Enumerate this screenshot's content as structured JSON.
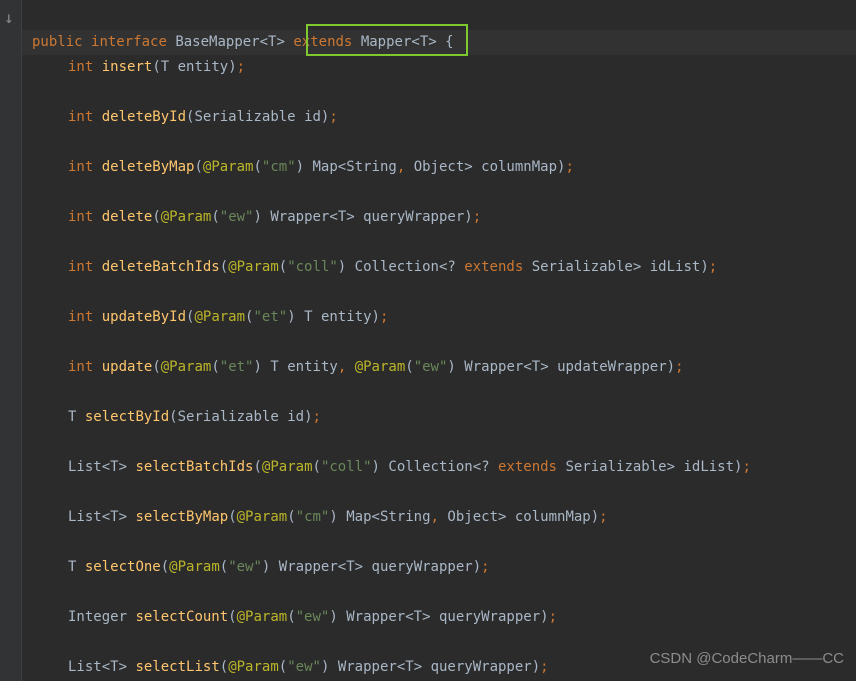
{
  "tokens": {
    "public": "public",
    "interface": "interface",
    "extends": "extends",
    "int": "int",
    "BaseMapper": "BaseMapper",
    "Mapper": "Mapper",
    "T": "T",
    "Serializable": "Serializable",
    "Map": "Map",
    "String": "String",
    "Object": "Object",
    "Wrapper": "Wrapper",
    "Collection": "Collection",
    "List": "List",
    "Integer": "Integer",
    "Param": "@Param"
  },
  "strings": {
    "cm": "\"cm\"",
    "ew": "\"ew\"",
    "coll": "\"coll\"",
    "et": "\"et\""
  },
  "methods": {
    "insert": "insert",
    "deleteById": "deleteById",
    "deleteByMap": "deleteByMap",
    "delete": "delete",
    "deleteBatchIds": "deleteBatchIds",
    "updateById": "updateById",
    "update": "update",
    "selectById": "selectById",
    "selectBatchIds": "selectBatchIds",
    "selectByMap": "selectByMap",
    "selectOne": "selectOne",
    "selectCount": "selectCount",
    "selectList": "selectList"
  },
  "params": {
    "entity": "entity",
    "id": "id",
    "columnMap": "columnMap",
    "queryWrapper": "queryWrapper",
    "idList": "idList",
    "updateWrapper": "updateWrapper"
  },
  "watermark": "CSDN @CodeCharm——CC",
  "arrow": "↓"
}
